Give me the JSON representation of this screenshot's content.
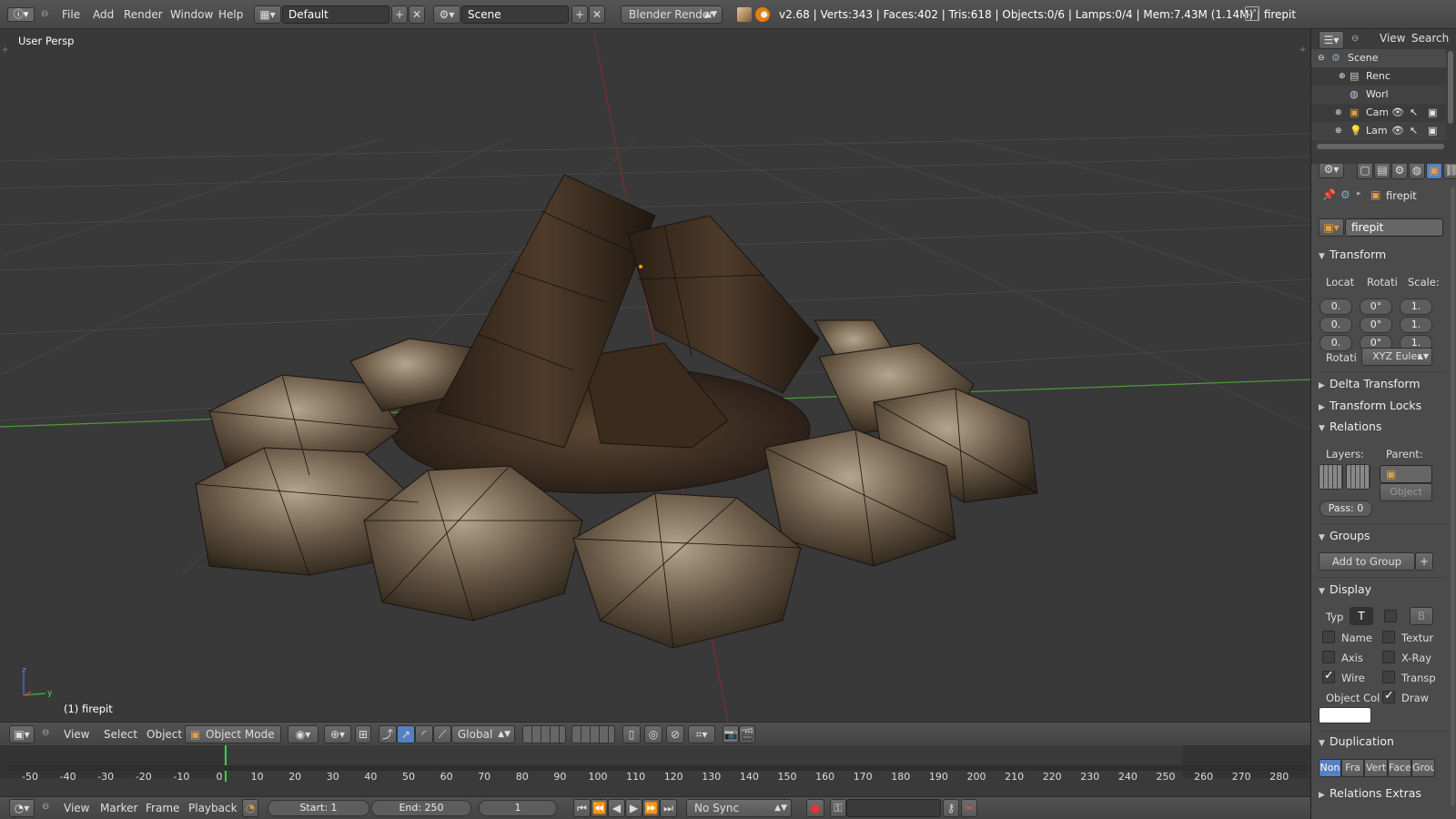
{
  "topbar": {
    "menus": [
      "File",
      "Add",
      "Render",
      "Window",
      "Help"
    ],
    "layout": "Default",
    "scene": "Scene",
    "engine": "Blender Render",
    "stats": "v2.68 | Verts:343 | Faces:402 | Tris:618 | Objects:0/6 | Lamps:0/4 | Mem:7.43M (1.14M) | firepit"
  },
  "viewport": {
    "view_label": "User Persp",
    "object_label": "(1) firepit"
  },
  "view3d_header": {
    "menus": [
      "View",
      "Select",
      "Object"
    ],
    "mode": "Object Mode",
    "orientation": "Global"
  },
  "timeline": {
    "ticks": [
      "-50",
      "-40",
      "-30",
      "-20",
      "-10",
      "0",
      "10",
      "20",
      "30",
      "40",
      "50",
      "60",
      "70",
      "80",
      "90",
      "100",
      "110",
      "120",
      "130",
      "140",
      "150",
      "160",
      "170",
      "180",
      "190",
      "200",
      "210",
      "220",
      "230",
      "240",
      "250",
      "260",
      "270",
      "280"
    ],
    "current_frame": 1
  },
  "timeline_header": {
    "menus": [
      "View",
      "Marker",
      "Frame",
      "Playback"
    ],
    "start": "Start: 1",
    "end": "End: 250",
    "frame": "1",
    "sync": "No Sync"
  },
  "outliner": {
    "menus": [
      "View",
      "Search"
    ],
    "items": [
      "Scene",
      "Renc",
      "Worl",
      "Cam",
      "Lamp"
    ]
  },
  "properties": {
    "breadcrumb": "firepit",
    "object_name": "firepit",
    "transform": {
      "title": "Transform",
      "loc_label": "Locat",
      "rot_label": "Rotati",
      "scale_label": "Scale:",
      "loc": [
        "0.",
        "0.",
        "0."
      ],
      "rot": [
        "0°",
        "0°",
        "0°"
      ],
      "scale": [
        "1.",
        "1.",
        "1."
      ],
      "rot_mode_label": "Rotati",
      "rot_mode": "XYZ Euler"
    },
    "delta": "Delta Transform",
    "locks": "Transform Locks",
    "relations": {
      "title": "Relations",
      "layers_label": "Layers:",
      "parent_label": "Parent:",
      "parent_type": "Object",
      "pass": "Pass: 0"
    },
    "groups": {
      "title": "Groups",
      "add": "Add to Group"
    },
    "display": {
      "title": "Display",
      "type_label": "Typ",
      "type_value": "T",
      "bounds_value": "B",
      "checks": [
        {
          "label": "Name",
          "on": false
        },
        {
          "label": "Textur",
          "on": false
        },
        {
          "label": "Axis",
          "on": false
        },
        {
          "label": "X-Ray",
          "on": false
        },
        {
          "label": "Wire",
          "on": true
        },
        {
          "label": "Transp",
          "on": false
        }
      ],
      "color_label": "Object Col",
      "draw_label": "Draw"
    },
    "duplication": {
      "title": "Duplication",
      "options": [
        "Non",
        "Fra",
        "Vert",
        "Face",
        "Grou"
      ]
    },
    "relations_extras": "Relations Extras"
  },
  "colors": {
    "accent": "#5680c2",
    "frame_marker": "#2fd34a",
    "x_axis": "#8b2b2b",
    "y_axis": "#4f9a3a"
  }
}
